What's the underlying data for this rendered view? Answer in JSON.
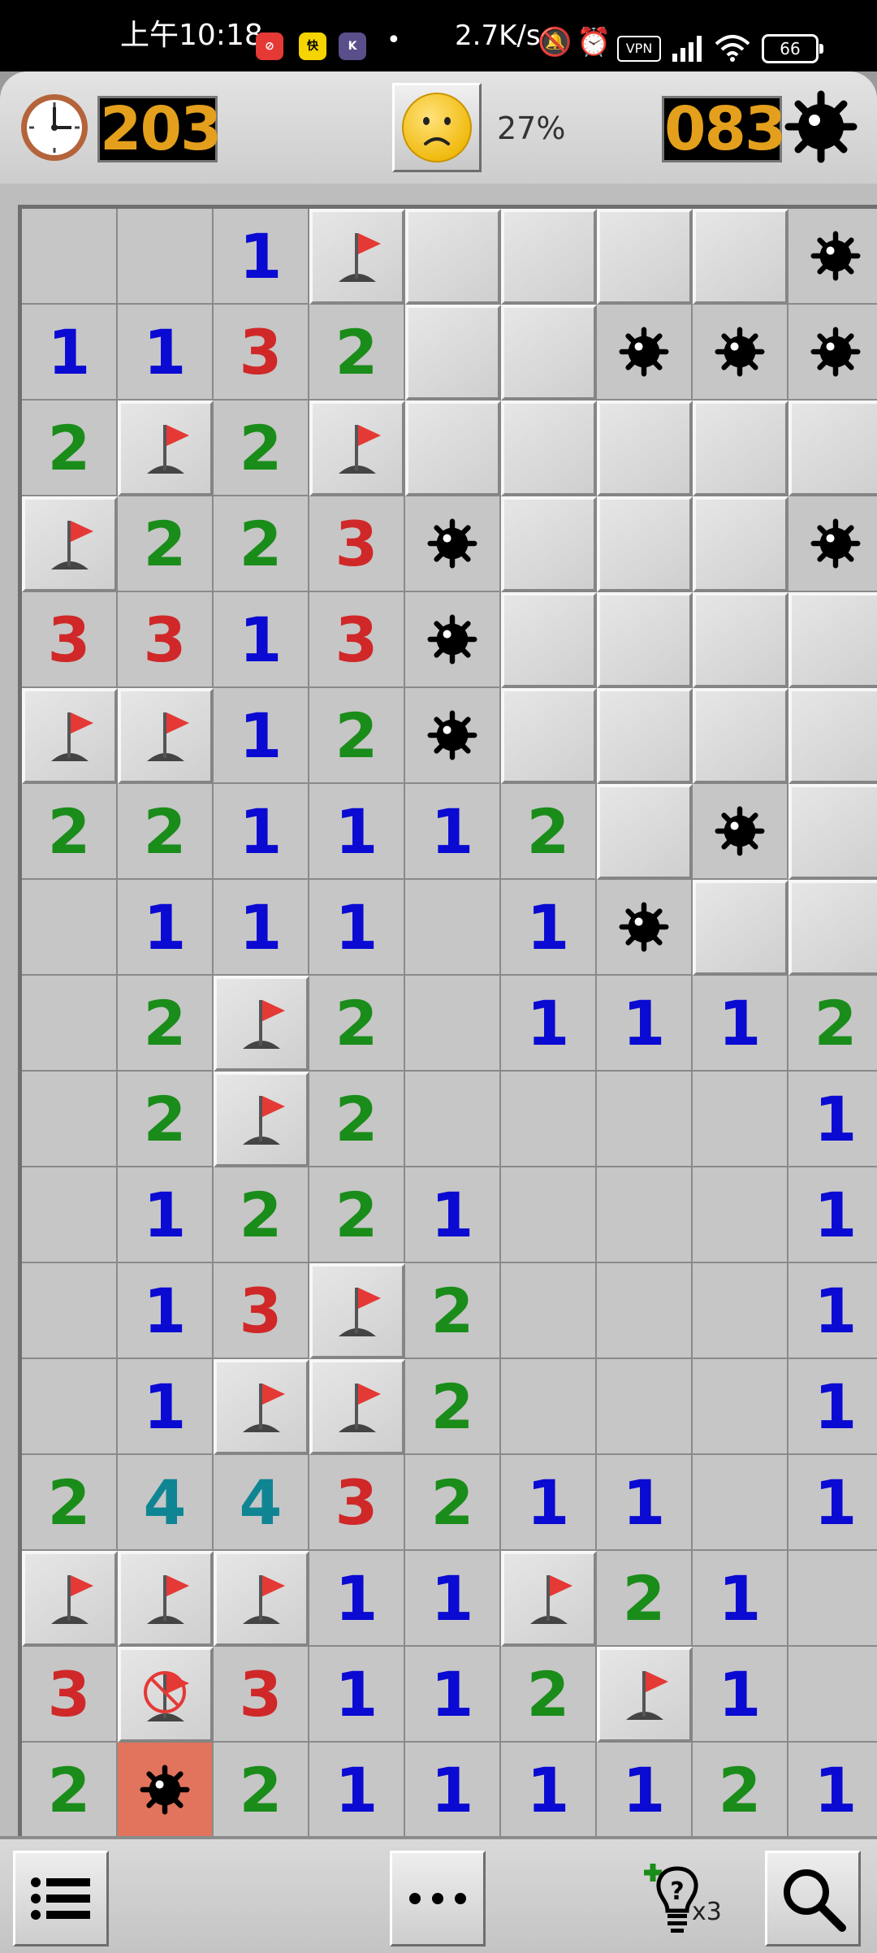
{
  "status_bar": {
    "time": "上午10:18",
    "app_icons": [
      "⊘",
      "快",
      "K"
    ],
    "dot": "•",
    "network_speed": "2.7K/s",
    "vpn": "VPN",
    "battery": "66",
    "icons": [
      "bell-off-icon",
      "alarm-icon",
      "vpn-icon",
      "signal-icon",
      "wifi-icon",
      "battery-icon"
    ]
  },
  "header": {
    "timer": "203",
    "mines_remaining": "083",
    "progress": "27%",
    "face": "worried-face"
  },
  "board": {
    "columns_visible": 9,
    "rows_visible": 17,
    "legend": "H=unrevealed, F=flag, X=wrong flag, M=mine, E=exploded mine, 0=empty, digits=adjacent mines",
    "rows": [
      [
        "0",
        "0",
        "1",
        "F",
        "H",
        "H",
        "H",
        "H",
        "M"
      ],
      [
        "1",
        "1",
        "3",
        "2",
        "H",
        "H",
        "M",
        "M",
        "M"
      ],
      [
        "2",
        "F",
        "2",
        "F",
        "H",
        "H",
        "H",
        "H",
        "H"
      ],
      [
        "F",
        "2",
        "2",
        "3",
        "M",
        "H",
        "H",
        "H",
        "M"
      ],
      [
        "3",
        "3",
        "1",
        "3",
        "M",
        "H",
        "H",
        "H",
        "H"
      ],
      [
        "F",
        "F",
        "1",
        "2",
        "M",
        "H",
        "H",
        "H",
        "H"
      ],
      [
        "2",
        "2",
        "1",
        "1",
        "1",
        "2",
        "H",
        "M",
        "H"
      ],
      [
        "0",
        "1",
        "1",
        "1",
        "0",
        "1",
        "M",
        "H",
        "H"
      ],
      [
        "0",
        "2",
        "F",
        "2",
        "0",
        "1",
        "1",
        "1",
        "2"
      ],
      [
        "0",
        "2",
        "F",
        "2",
        "0",
        "0",
        "0",
        "0",
        "1"
      ],
      [
        "0",
        "1",
        "2",
        "2",
        "1",
        "0",
        "0",
        "0",
        "1"
      ],
      [
        "0",
        "1",
        "3",
        "F",
        "2",
        "0",
        "0",
        "0",
        "1"
      ],
      [
        "0",
        "1",
        "F",
        "F",
        "2",
        "0",
        "0",
        "0",
        "1"
      ],
      [
        "2",
        "4",
        "4",
        "3",
        "2",
        "1",
        "1",
        "0",
        "1"
      ],
      [
        "F",
        "F",
        "F",
        "1",
        "1",
        "F",
        "2",
        "1",
        "0"
      ],
      [
        "3",
        "X",
        "3",
        "1",
        "1",
        "2",
        "F",
        "1",
        "0"
      ],
      [
        "2",
        "E",
        "2",
        "1",
        "1",
        "1",
        "1",
        "2",
        "1"
      ]
    ]
  },
  "bottom_bar": {
    "hint_count": "x3",
    "buttons": [
      "menu",
      "more",
      "hint",
      "zoom"
    ]
  },
  "colors": {
    "n1": "#0a0ad2",
    "n2": "#1a8c1a",
    "n3": "#d02828",
    "n4": "#0f8593",
    "led": "#e4a01c",
    "exploded": "#e2735c",
    "flag": "#e53935"
  }
}
